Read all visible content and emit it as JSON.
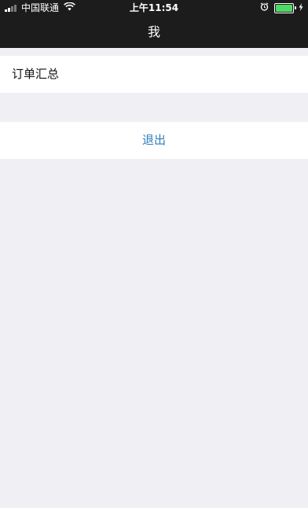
{
  "status_bar": {
    "carrier": "中国联通",
    "time": "上午11:54",
    "battery_level": 1.0,
    "battery_color": "#4cd964"
  },
  "nav": {
    "title": "我"
  },
  "menu": {
    "orders_summary_label": "订单汇总",
    "logout_label": "退出",
    "logout_color": "#2e7dbd"
  },
  "icons": {
    "signal": "signal-strength-icon",
    "wifi": "wifi-icon",
    "alarm": "alarm-clock-icon",
    "battery": "battery-icon",
    "charging": "charging-bolt-icon"
  }
}
